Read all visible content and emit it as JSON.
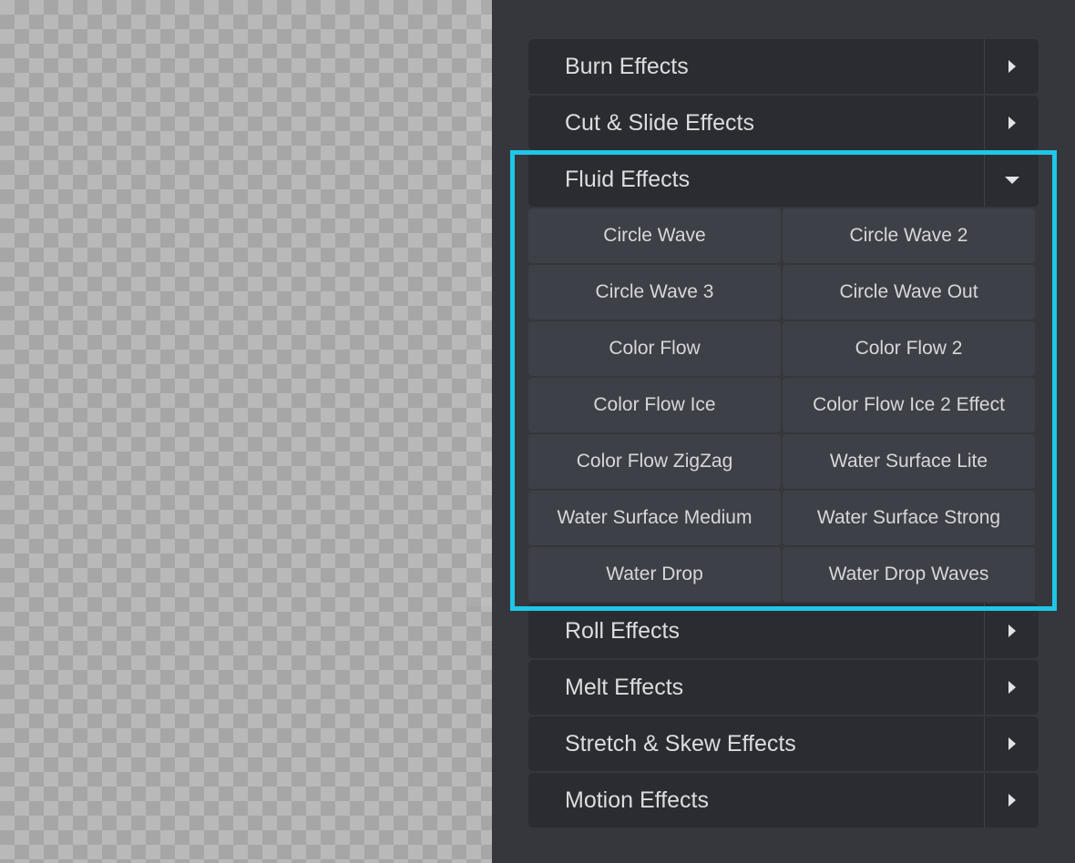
{
  "colors": {
    "panel_bg": "#35373c",
    "row_bg": "#2b2c31",
    "sub_item_bg": "#3d4047",
    "text": "#dcdde0",
    "highlight": "#20c6e6"
  },
  "categories_before": [
    {
      "label": "Burn Effects",
      "toggle_icon": "caret-right-icon"
    },
    {
      "label": "Cut & Slide Effects",
      "toggle_icon": "caret-right-icon"
    }
  ],
  "expanded_category": {
    "label": "Fluid Effects",
    "toggle_icon": "caret-down-icon",
    "items": [
      "Circle Wave",
      "Circle Wave 2",
      "Circle Wave 3",
      "Circle Wave Out",
      "Color Flow",
      "Color Flow 2",
      "Color Flow Ice",
      "Color Flow Ice 2 Effect",
      "Color Flow ZigZag",
      "Water Surface Lite",
      "Water Surface Medium",
      "Water Surface Strong",
      "Water Drop",
      "Water Drop Waves"
    ]
  },
  "categories_after": [
    {
      "label": "Roll Effects",
      "toggle_icon": "caret-right-icon"
    },
    {
      "label": "Melt Effects",
      "toggle_icon": "caret-right-icon"
    },
    {
      "label": "Stretch & Skew Effects",
      "toggle_icon": "caret-right-icon"
    },
    {
      "label": "Motion Effects",
      "toggle_icon": "caret-right-icon"
    }
  ]
}
